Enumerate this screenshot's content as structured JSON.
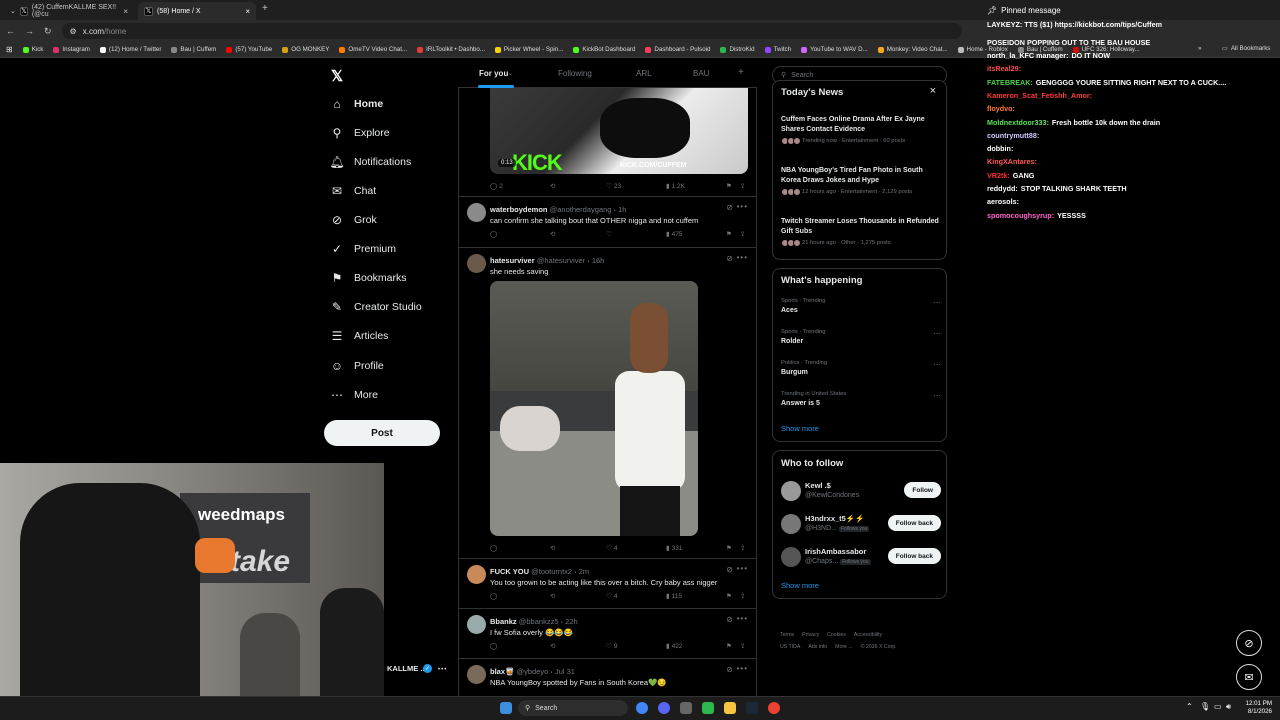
{
  "browser": {
    "tabs": [
      {
        "label": "(42) CuffemKALLME SEX!! (@cu",
        "close": "×"
      },
      {
        "label": "(58) Home / X",
        "close": "×"
      }
    ],
    "new_tab": "+",
    "url_domain": "x.com",
    "url_path": "/home",
    "bookmarks": [
      {
        "label": "Kick",
        "color": "#53fc18"
      },
      {
        "label": "Instagram",
        "color": "#e1306c"
      },
      {
        "label": "(12) Home / Twitter",
        "color": "#ffffff"
      },
      {
        "label": "Bau | Cuffem",
        "color": "#888888"
      },
      {
        "label": "(57) YouTube",
        "color": "#ff0000"
      },
      {
        "label": "OG MONKEY",
        "color": "#d4a017"
      },
      {
        "label": "OmeTV Video Chat...",
        "color": "#ff7a00"
      },
      {
        "label": "IRLToolkit • Dashbo...",
        "color": "#e03c3c"
      },
      {
        "label": "Picker Wheel - Spin...",
        "color": "#f5d20a"
      },
      {
        "label": "KickBot Dashboard",
        "color": "#53fc18"
      },
      {
        "label": "Dashboard - Pulsoid",
        "color": "#ff3b5c"
      },
      {
        "label": "DistroKid",
        "color": "#2db84d"
      },
      {
        "label": "Twitch",
        "color": "#9146ff"
      },
      {
        "label": "YouTube to WAV D...",
        "color": "#cc66ff"
      },
      {
        "label": "Monkey: Video Chat...",
        "color": "#f5a623"
      },
      {
        "label": "Home - Roblox",
        "color": "#bbbbbb"
      },
      {
        "label": "Bau | Cuffem",
        "color": "#888888"
      },
      {
        "label": "UFC 326: Holloway...",
        "color": "#d20a0a"
      }
    ],
    "bookmarks_more": "»",
    "all_bookmarks": "All Bookmarks"
  },
  "nav": {
    "items": [
      {
        "label": "Home",
        "icon": "home-icon",
        "glyph": "⌂"
      },
      {
        "label": "Explore",
        "icon": "search-icon",
        "glyph": "⚲"
      },
      {
        "label": "Notifications",
        "icon": "bell-icon",
        "glyph": "🔔︎"
      },
      {
        "label": "Chat",
        "icon": "chat-icon",
        "glyph": "✉"
      },
      {
        "label": "Grok",
        "icon": "grok-icon",
        "glyph": "⊘"
      },
      {
        "label": "Premium",
        "icon": "premium-icon",
        "glyph": "✓"
      },
      {
        "label": "Bookmarks",
        "icon": "bookmark-icon",
        "glyph": "⚑"
      },
      {
        "label": "Creator Studio",
        "icon": "creator-studio-icon",
        "glyph": "✎"
      },
      {
        "label": "Articles",
        "icon": "articles-icon",
        "glyph": "☰"
      },
      {
        "label": "Profile",
        "icon": "profile-icon",
        "glyph": "☺"
      },
      {
        "label": "More",
        "icon": "more-icon",
        "glyph": "⋯"
      }
    ],
    "chat_badge": "20+",
    "post_label": "Post",
    "account_name": "KALLME ...",
    "account_more": "•••"
  },
  "feed": {
    "tabs": [
      "For you",
      "Following",
      "ARL",
      "BAU"
    ],
    "add_tab": "+",
    "video": {
      "time": "0:13",
      "watermark": "KICK",
      "url": "KICK.COM/CUFFEM"
    },
    "first_actions": {
      "replies": "2",
      "likes": "23",
      "views": "1.2K"
    },
    "tweets": [
      {
        "name": "waterboydemon",
        "handle": "@anotherdaygang",
        "time": "1h",
        "text": "can confirm she talking bout that OTHER nigga and not cuffem",
        "replies": "",
        "reposts": "",
        "likes": "",
        "views": "475"
      },
      {
        "name": "hatesurviver",
        "handle": "@hatesurviver",
        "time": "16h",
        "text": "she needs saving",
        "replies": "",
        "reposts": "",
        "likes": "4",
        "views": "331"
      },
      {
        "name": "FUCK YOU",
        "handle": "@tooturntx2",
        "time": "2m",
        "text": "You too grown to be acting like this over a bitch. Cry baby ass nigger",
        "replies": "",
        "reposts": "",
        "likes": "4",
        "views": "115"
      },
      {
        "name": "Bbankz",
        "handle": "@bbankzz5",
        "time": "22h",
        "text": "I fw Sofia overly 😂😂😂",
        "replies": "",
        "reposts": "",
        "likes": "9",
        "views": "422"
      },
      {
        "name": "blax🥃",
        "handle": "@ybdeyo",
        "time": "Jul 31",
        "text": "NBA YoungBoy spotted by Fans in South Korea💚😏",
        "replies": "",
        "reposts": "",
        "likes": "",
        "views": ""
      }
    ]
  },
  "right": {
    "search_placeholder": "Search",
    "news_title": "Today's News",
    "news_close": "×",
    "news": [
      {
        "title": "Cuffem Faces Online Drama After Ex Jayne Shares Contact Evidence",
        "meta": "Trending now · Entertainment · 60 posts"
      },
      {
        "title": "NBA YoungBoy's Tired Fan Photo in South Korea Draws Jokes and Hype",
        "meta": "12 hours ago · Entertainment · 2,129 posts"
      },
      {
        "title": "Twitch Streamer Loses Thousands in Refunded Gift Subs",
        "meta": "21 hours ago · Other · 1,275 posts"
      }
    ],
    "happening_title": "What's happening",
    "trends": [
      {
        "context": "Sports · Trending",
        "name": "Aces"
      },
      {
        "context": "Sports · Trending",
        "name": "Rolder"
      },
      {
        "context": "Politics · Trending",
        "name": "Burgum"
      },
      {
        "context": "Trending in United States",
        "name": "Answer is 5"
      }
    ],
    "show_more": "Show more",
    "who_title": "Who to follow",
    "follow": [
      {
        "name": "Kewl .$",
        "handle": "@KewlCondones",
        "follows_you": "",
        "button": "Follow"
      },
      {
        "name": "H3ndrxx_t5⚡⚡",
        "handle": "@H3ND...",
        "follows_you": "Follows you",
        "button": "Follow back"
      },
      {
        "name": "IrishAmbassabor",
        "handle": "@Chaps...",
        "follows_you": "Follows you",
        "button": "Follow back"
      }
    ],
    "footer": [
      "Terms",
      "Privacy",
      "Cookies",
      "Accessibility",
      "US TIDA",
      "Ads info",
      "More ...",
      "© 2026 X Corp."
    ]
  },
  "chat": {
    "pinned_label": "Pinned message",
    "pinned_text": "LAYKEYZ: TTS ($1) https://kickbot.com/tips/Cuffem",
    "pinned_cont": "POSEIDON POPPING OUT TO THE BAU HOUSE",
    "messages": [
      {
        "user": "north_la_KFC manager:",
        "text": "DO IT NOW",
        "color": "#ffffff"
      },
      {
        "user": "itsReal29:",
        "text": "",
        "color": "#ff4f4f"
      },
      {
        "user": "FATEBREAK:",
        "text": "GENGGGG YOURE SITTING RIGHT NEXT TO A CUCK....",
        "color": "#4fd14f"
      },
      {
        "user": "Kameron_Scat_Fetishh_Amor:",
        "text": "",
        "color": "#ff3b3b"
      },
      {
        "user": "floydvo:",
        "text": "",
        "color": "#ff7b3b"
      },
      {
        "user": "Moldnextdoor333:",
        "text": "Fresh bottle 10k down the drain",
        "color": "#5be35b"
      },
      {
        "user": "countrymutt88:",
        "text": "",
        "color": "#d0c7ff"
      },
      {
        "user": "dobbin:",
        "text": "",
        "color": "#ffffff"
      },
      {
        "user": "KingXAntares:",
        "text": "",
        "color": "#ff5a5a"
      },
      {
        "user": "VR2tk:",
        "text": "GANG",
        "color": "#ff3030"
      },
      {
        "user": "reddydd:",
        "text": "STOP TALKING SHARK TEETH",
        "color": "#ffffff"
      },
      {
        "user": "aerosols:",
        "text": "",
        "color": "#ffffff"
      },
      {
        "user": "spomocoughsyrup:",
        "text": "YESSSS",
        "color": "#ff66cc"
      }
    ]
  },
  "webcam": {
    "banner_text": "weedmaps",
    "wall_text": "take"
  },
  "taskbar": {
    "search_placeholder": "Search",
    "time": "12:01 PM",
    "date": "8/1/2026"
  }
}
